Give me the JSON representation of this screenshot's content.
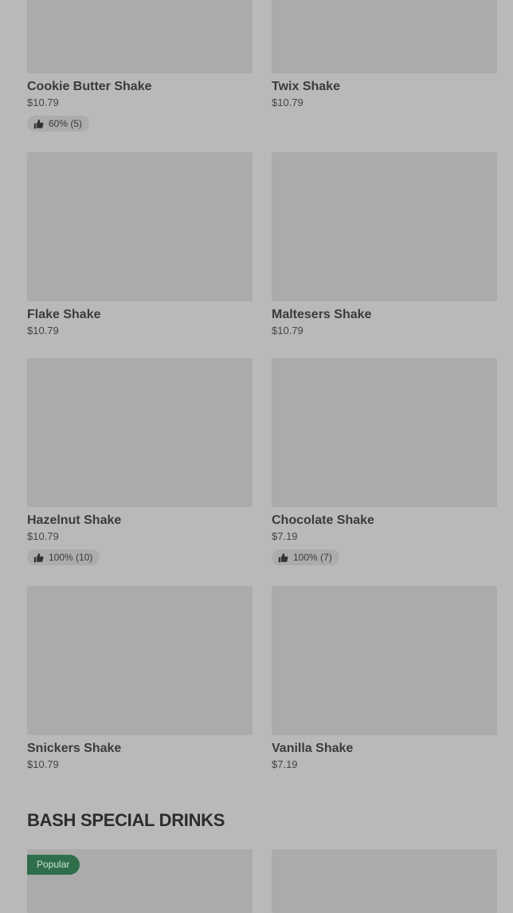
{
  "items": [
    {
      "name": "Cookie Butter Shake",
      "price": "$10.79",
      "rating": "60% (5)"
    },
    {
      "name": "Twix Shake",
      "price": "$10.79",
      "rating": null
    },
    {
      "name": "Flake Shake",
      "price": "$10.79",
      "rating": null
    },
    {
      "name": "Maltesers Shake",
      "price": "$10.79",
      "rating": null
    },
    {
      "name": "Hazelnut Shake",
      "price": "$10.79",
      "rating": "100% (10)"
    },
    {
      "name": "Chocolate Shake",
      "price": "$7.19",
      "rating": "100% (7)"
    },
    {
      "name": "Snickers Shake",
      "price": "$10.79",
      "rating": null
    },
    {
      "name": "Vanilla Shake",
      "price": "$7.19",
      "rating": null
    }
  ],
  "section": {
    "title": "BASH SPECIAL DRINKS"
  },
  "bottom": {
    "badge": "Popular"
  },
  "icons": {
    "rating": "thumbs-up-icon"
  }
}
